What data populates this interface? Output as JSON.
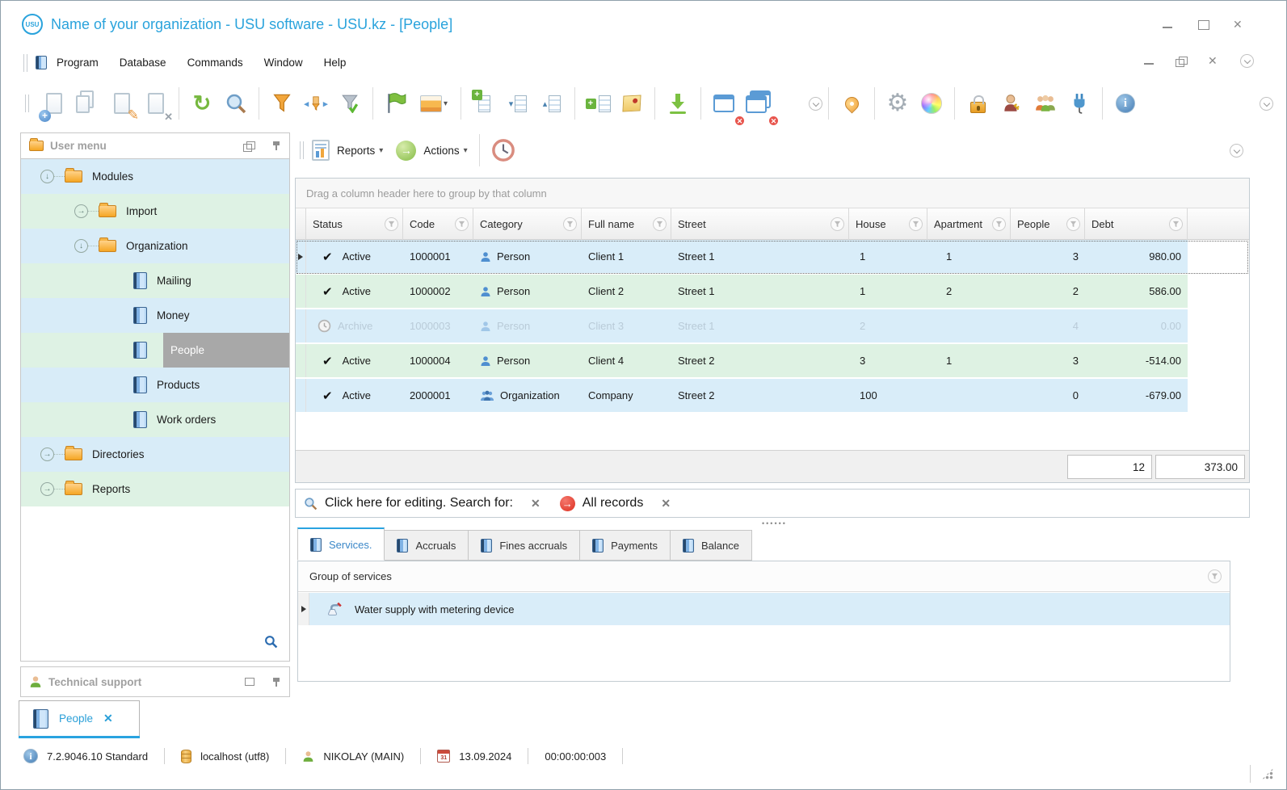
{
  "window": {
    "title": "Name of your organization - USU software - USU.kz - [People]"
  },
  "menu": {
    "items": [
      "Program",
      "Database",
      "Commands",
      "Window",
      "Help"
    ]
  },
  "toolbar": {
    "icons": [
      "new-record",
      "copy-record",
      "edit-record",
      "delete-record",
      "refresh",
      "search",
      "filter",
      "filter-columns",
      "filter-apply",
      "flag",
      "image-view",
      "grid-settings",
      "expand-tree",
      "collapse-tree",
      "add-table",
      "notes",
      "export-download",
      "close-window",
      "close-all-windows",
      "collapse-chevron",
      "location-pin",
      "settings-gear",
      "appearance-colors",
      "lock",
      "user-permissions",
      "users-group",
      "plugin",
      "info",
      "expand-chevron"
    ]
  },
  "panel_toolbar": {
    "reports_label": "Reports",
    "actions_label": "Actions"
  },
  "sidebar": {
    "title": "User menu",
    "items": [
      {
        "label": "Modules"
      },
      {
        "label": "Import"
      },
      {
        "label": "Organization"
      },
      {
        "label": "Mailing"
      },
      {
        "label": "Money"
      },
      {
        "label": "People"
      },
      {
        "label": "Products"
      },
      {
        "label": "Work orders"
      },
      {
        "label": "Directories"
      },
      {
        "label": "Reports"
      }
    ],
    "support_label": "Technical support"
  },
  "grid": {
    "group_hint": "Drag a column header here to group by that column",
    "columns": [
      "Status",
      "Code",
      "Category",
      "Full name",
      "Street",
      "House",
      "Apartment",
      "People",
      "Debt"
    ],
    "rows": [
      {
        "status": "Active",
        "code": "1000001",
        "category": "Person",
        "full_name": "Client 1",
        "street": "Street 1",
        "house": "1",
        "apartment": "1",
        "people": "3",
        "debt": "980.00"
      },
      {
        "status": "Active",
        "code": "1000002",
        "category": "Person",
        "full_name": "Client 2",
        "street": "Street 1",
        "house": "1",
        "apartment": "2",
        "people": "2",
        "debt": "586.00"
      },
      {
        "status": "Archive",
        "code": "1000003",
        "category": "Person",
        "full_name": "Client 3",
        "street": "Street 1",
        "house": "2",
        "apartment": "",
        "people": "4",
        "debt": "0.00"
      },
      {
        "status": "Active",
        "code": "1000004",
        "category": "Person",
        "full_name": "Client 4",
        "street": "Street 2",
        "house": "3",
        "apartment": "1",
        "people": "3",
        "debt": "-514.00"
      },
      {
        "status": "Active",
        "code": "2000001",
        "category": "Organization",
        "full_name": "Company",
        "street": "Street 2",
        "house": "100",
        "apartment": "",
        "people": "0",
        "debt": "-679.00"
      }
    ],
    "totals": {
      "people": "12",
      "debt": "373.00"
    }
  },
  "filter_bar": {
    "edit_hint": "Click here for editing. Search for:",
    "active_filter": "All records"
  },
  "detail_tabs": {
    "items": [
      "Services.",
      "Accruals",
      "Fines accruals",
      "Payments",
      "Balance"
    ],
    "active": "Services."
  },
  "services": {
    "column": "Group of services",
    "rows": [
      {
        "name": "Water supply with metering device"
      }
    ]
  },
  "document_tabs": {
    "items": [
      {
        "label": "People"
      }
    ]
  },
  "status_bar": {
    "version": "7.2.9046.10 Standard",
    "database": "localhost (utf8)",
    "user": "NIKOLAY (MAIN)",
    "date": "13.09.2024",
    "time": "00:00:00:003"
  },
  "colors": {
    "title_blue": "#2aa3dc",
    "active_tab_border": "#29a3e0",
    "row_blue": "#d9edf9",
    "row_green": "#def2e3",
    "selected_gray": "#a8a8a8",
    "archived_text": "#b9cbd8"
  }
}
